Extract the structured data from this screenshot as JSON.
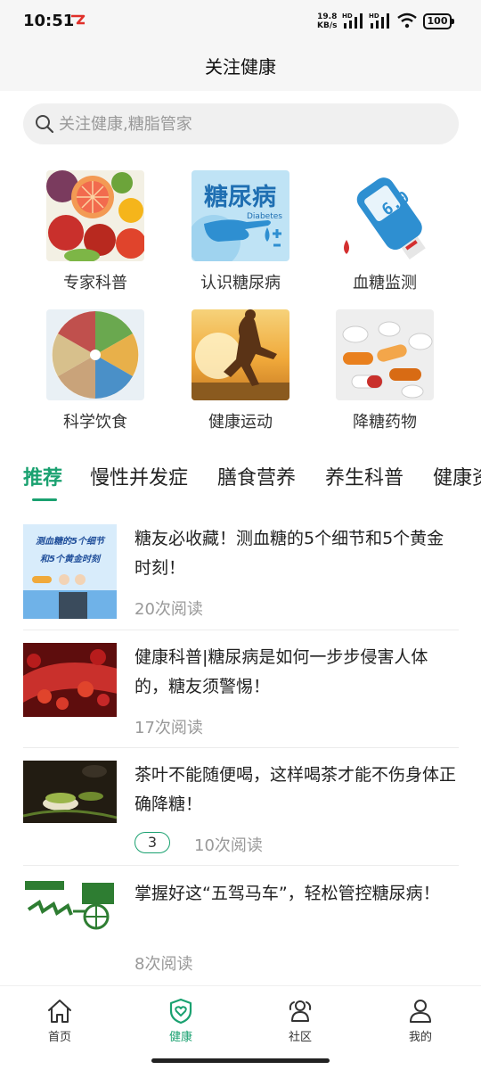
{
  "status_bar": {
    "time": "10:51",
    "speed_value": "19.8",
    "speed_unit": "KB/s",
    "battery": "100"
  },
  "header": {
    "title": "关注健康"
  },
  "search": {
    "placeholder": "关注健康,糖脂管家"
  },
  "categories": [
    {
      "label": "专家科普",
      "icon": "fruit-photo"
    },
    {
      "label": "认识糖尿病",
      "icon": "diabetes-banner",
      "banner_text": "糖尿病",
      "banner_sub": "Diabetes"
    },
    {
      "label": "血糖监测",
      "icon": "glucose-meter",
      "meter_value": "6.0"
    },
    {
      "label": "科学饮食",
      "icon": "food-plate-photo"
    },
    {
      "label": "健康运动",
      "icon": "runner-photo"
    },
    {
      "label": "降糖药物",
      "icon": "pills-photo"
    }
  ],
  "tabs": [
    {
      "label": "推荐",
      "active": true
    },
    {
      "label": "慢性并发症",
      "active": false
    },
    {
      "label": "膳食营养",
      "active": false
    },
    {
      "label": "养生科普",
      "active": false
    },
    {
      "label": "健康资",
      "active": false
    }
  ],
  "articles": [
    {
      "title": "糖友必收藏！测血糖的5个细节和5个黄金时刻！",
      "reads": "20次阅读",
      "thumb_text_1": "测血糖的5个细节",
      "thumb_text_2": "和5个黄金时刻"
    },
    {
      "title": "健康科普|糖尿病是如何一步步侵害人体的，糖友须警惕！",
      "reads": "17次阅读"
    },
    {
      "title": "茶叶不能随便喝，这样喝茶才能不伤身体正确降糖！",
      "badge": "3",
      "reads": "10次阅读"
    },
    {
      "title": "掌握好这“五驾马车”，轻松管控糖尿病！",
      "reads": "8次阅读"
    }
  ],
  "bottom_nav": [
    {
      "label": "首页",
      "icon": "home-icon",
      "active": false
    },
    {
      "label": "健康",
      "icon": "shield-heart-icon",
      "active": true
    },
    {
      "label": "社区",
      "icon": "community-icon",
      "active": false
    },
    {
      "label": "我的",
      "icon": "user-icon",
      "active": false
    }
  ],
  "colors": {
    "accent": "#1aa170",
    "text": "#222222",
    "muted": "#999999"
  }
}
